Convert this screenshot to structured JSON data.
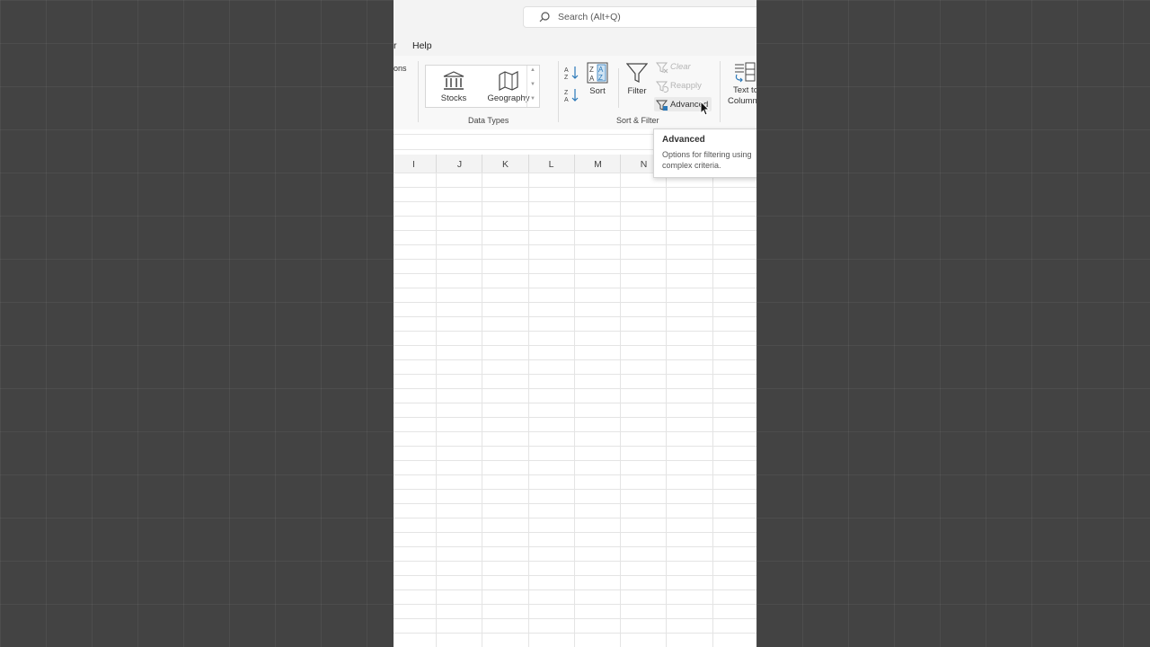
{
  "window": {
    "search_placeholder": "Search (Alt+Q)"
  },
  "menu": {
    "partial_tab": "r",
    "help": "Help"
  },
  "ribbon": {
    "partial_left_label": "ons",
    "data_types": {
      "label": "Data Types",
      "stocks": "Stocks",
      "geography": "Geography"
    },
    "sort_filter": {
      "label": "Sort & Filter",
      "sort": "Sort",
      "filter": "Filter",
      "clear": "Clear",
      "reapply": "Reapply",
      "advanced": "Advanced"
    },
    "text_to_columns": {
      "line1": "Text to",
      "line2": "Columns"
    }
  },
  "grid": {
    "columns": [
      "I",
      "J",
      "K",
      "L",
      "M",
      "N"
    ]
  },
  "tooltip": {
    "title": "Advanced",
    "description": "Options for filtering using complex criteria."
  },
  "colors": {
    "accent_blue": "#2a78b8",
    "page_dim": "#434343"
  }
}
